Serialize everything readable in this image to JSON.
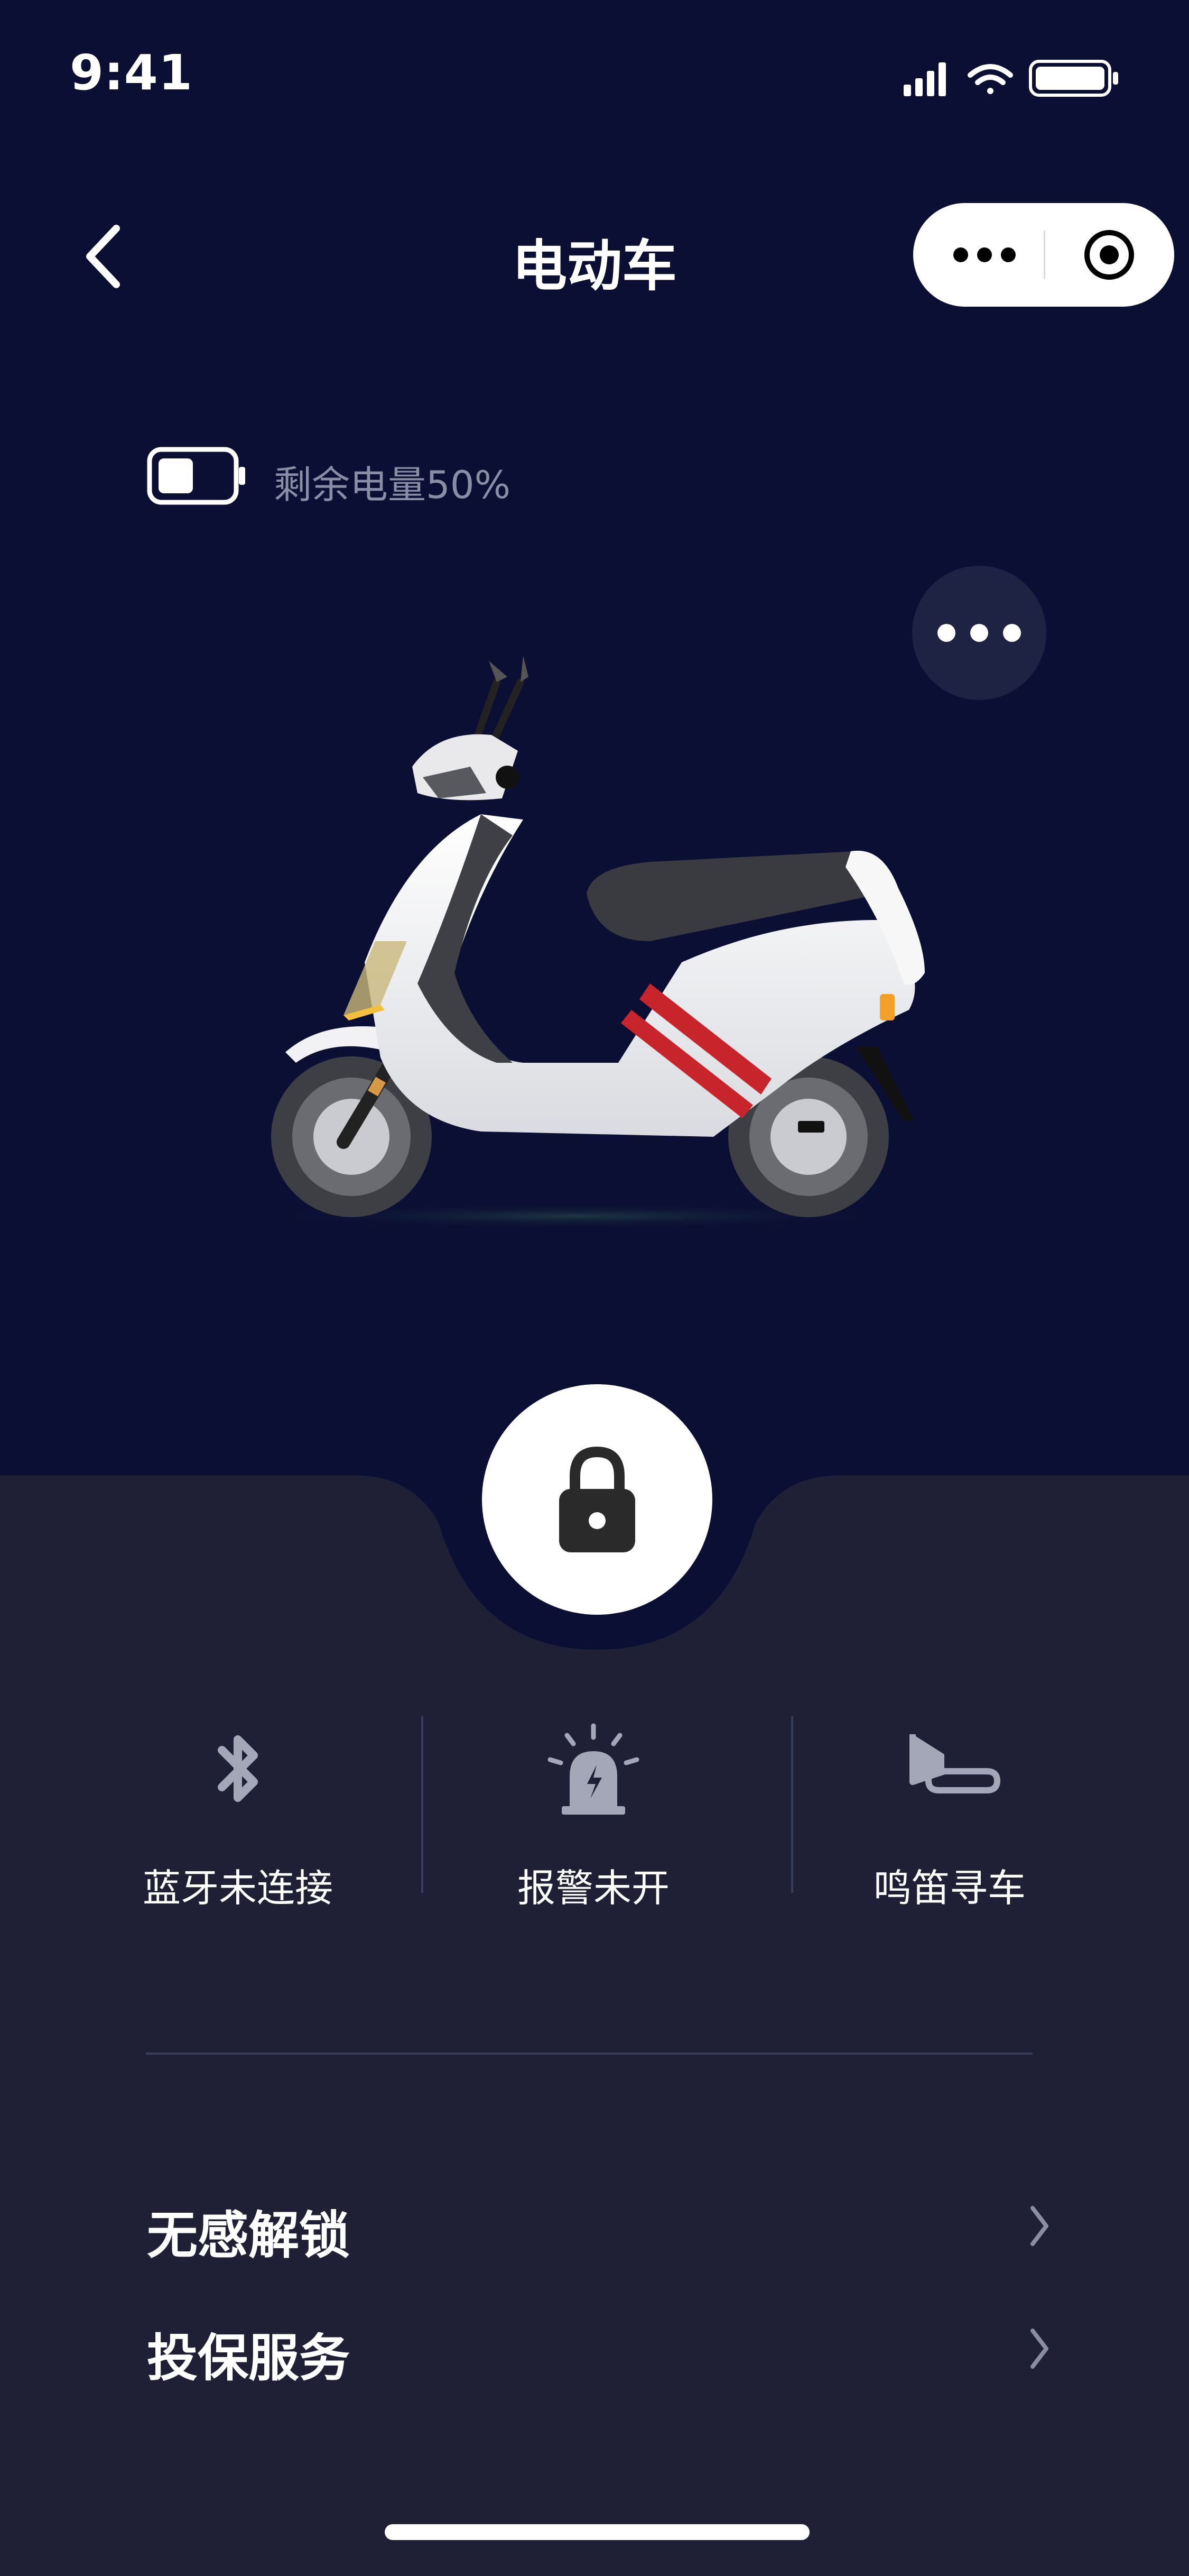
{
  "status_bar": {
    "time": "9:41",
    "icons": [
      "signal-icon",
      "wifi-icon",
      "battery-icon"
    ]
  },
  "nav": {
    "title": "电动车",
    "back_icon": "chevron-left-icon",
    "capsule": {
      "more_icon": "more-dots-icon",
      "close_icon": "target-close-icon"
    }
  },
  "battery": {
    "label": "剩余电量50%",
    "level": 0.5
  },
  "vehicle": {
    "more_icon": "more-dots-icon",
    "image": "electric-scooter"
  },
  "lock": {
    "icon": "padlock-icon"
  },
  "quick_actions": [
    {
      "label": "蓝牙未连接",
      "icon": "bluetooth-icon"
    },
    {
      "label": "报警未开",
      "icon": "alarm-siren-icon"
    },
    {
      "label": "鸣笛寻车",
      "icon": "horn-icon"
    }
  ],
  "menu": [
    {
      "label": "无感解锁",
      "icon": "chevron-right-icon"
    },
    {
      "label": "投保服务",
      "icon": "chevron-right-icon"
    }
  ],
  "colors": {
    "background": "#0b0f33",
    "panel": "#1f2036",
    "muted_text": "#8a8ea5",
    "icon_gray": "#a4a7b8",
    "stripe_red": "#c8242c"
  }
}
